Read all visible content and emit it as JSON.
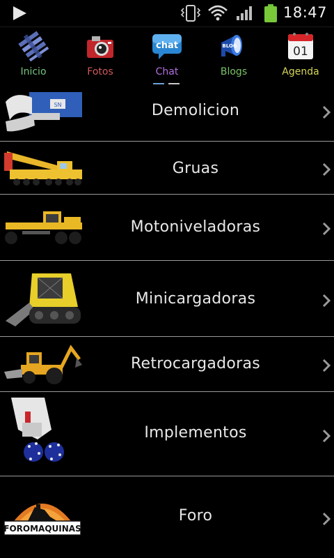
{
  "status_bar": {
    "time": "18:47",
    "icons": [
      "play-icon",
      "vibrate-icon",
      "wifi-icon",
      "signal-icon",
      "battery-icon"
    ]
  },
  "tabs": [
    {
      "label": "Inicio",
      "icon": "inicio-icon",
      "color": "#76c47c"
    },
    {
      "label": "Fotos",
      "icon": "camera-icon",
      "color": "#d05a5a"
    },
    {
      "label": "Chat",
      "icon": "chat-icon",
      "color": "#b36ee0",
      "selected": true
    },
    {
      "label": "Blogs",
      "icon": "blog-megaphone-icon",
      "color": "#79c466"
    },
    {
      "label": "Agenda",
      "icon": "calendar-icon",
      "color": "#d6d65a"
    }
  ],
  "calendar_day": "01",
  "chat_badge": "chat",
  "blog_badge": "BLOG",
  "categories": [
    {
      "label": "Demolicion",
      "thumb": "demolition-shear-image"
    },
    {
      "label": "Gruas",
      "thumb": "crane-truck-image"
    },
    {
      "label": "Motoniveladoras",
      "thumb": "motor-grader-image"
    },
    {
      "label": "Minicargadoras",
      "thumb": "skid-steer-image"
    },
    {
      "label": "Retrocargadoras",
      "thumb": "backhoe-loader-image"
    },
    {
      "label": "Implementos",
      "thumb": "implement-drum-cutter-image"
    },
    {
      "label": "Foro",
      "thumb": "foromaquinas-logo"
    }
  ],
  "foro_logo_text": "FOROMAQUINAS"
}
